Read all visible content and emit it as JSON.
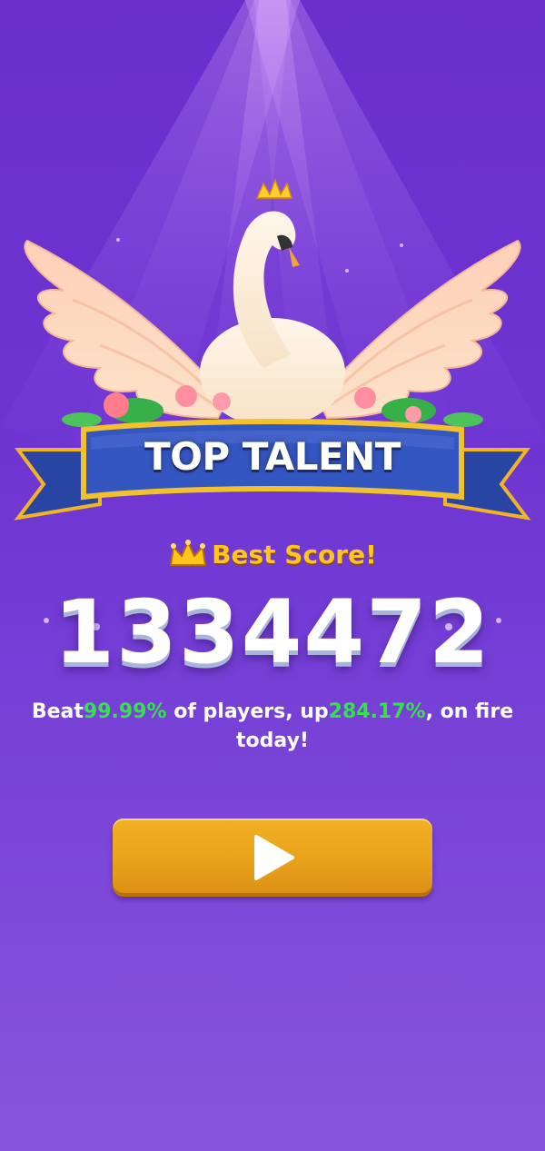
{
  "banner": {
    "title": "TOP TALENT"
  },
  "best": {
    "label": "Best Score!",
    "icon": "crown-icon"
  },
  "score": {
    "value": "1334472"
  },
  "stats": {
    "prefix": "Beat",
    "beat_percent": "99.99%",
    "middle": " of players,  up",
    "up_percent": "284.17%",
    "suffix": ", on fire today!"
  },
  "play_button": {
    "icon": "play-icon"
  },
  "colors": {
    "background_top": "#6a2fcc",
    "background_bottom": "#8755dc",
    "gold": "#ffc51c",
    "green": "#37e04e",
    "banner_blue": "#2f4bb0",
    "button_gold": "#e9a21c"
  }
}
